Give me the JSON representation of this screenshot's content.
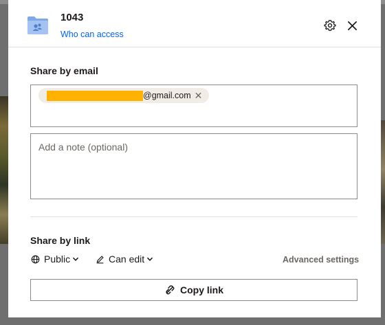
{
  "header": {
    "title": "1043",
    "access_link": "Who can access",
    "folder_icon": "shared-folder-icon",
    "accent": "#0061fe"
  },
  "email_section": {
    "title": "Share by email",
    "recipient_suffix": "@gmail.com",
    "recipient_redacted": true,
    "note_placeholder": "Add a note (optional)"
  },
  "link_section": {
    "title": "Share by link",
    "audience": "Public",
    "permission": "Can edit",
    "advanced_settings": "Advanced settings",
    "copy_link": "Copy link"
  }
}
